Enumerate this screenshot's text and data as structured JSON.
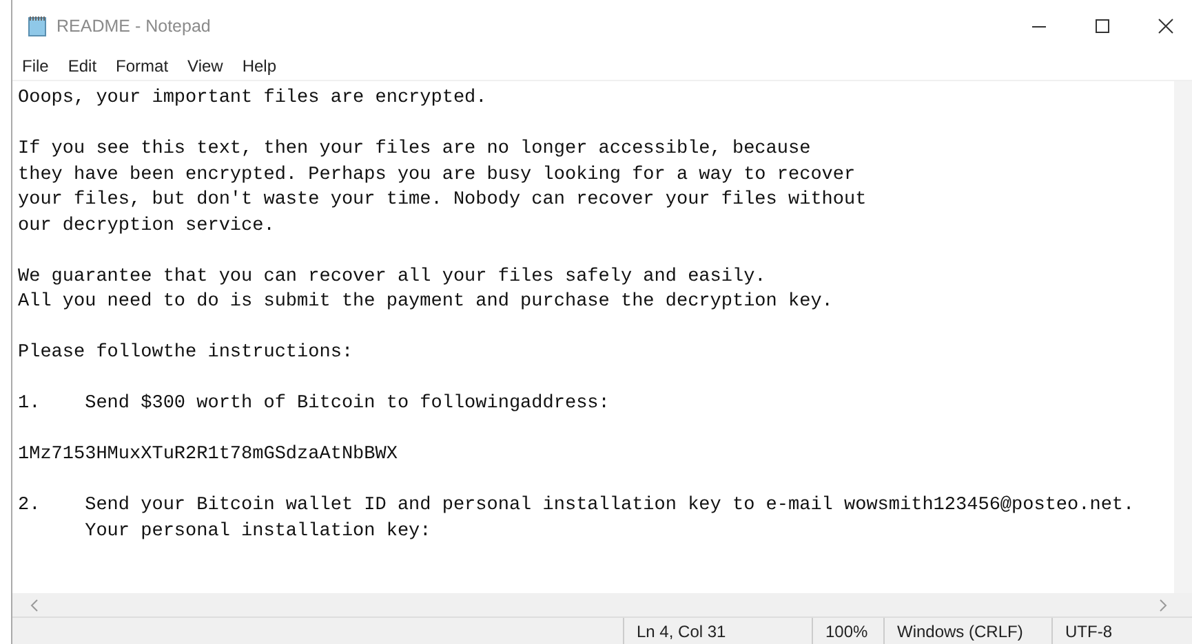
{
  "window": {
    "title": "README - Notepad"
  },
  "menu": [
    "File",
    "Edit",
    "Format",
    "View",
    "Help"
  ],
  "editor": {
    "paragraphs": [
      [
        "Ooops, your important files are encrypted."
      ],
      [
        "If you see this text, then your files are no longer accessible, because",
        "they have been encrypted. Perhaps you are busy looking for a way to recover",
        "your files, but don't waste your time. Nobody can recover your files without",
        "our decryption service."
      ],
      [
        "We guarantee that you can recover all your files safely and easily.",
        "All you need to do is submit the payment and purchase the decryption key."
      ],
      [
        "Please followthe instructions:"
      ],
      [
        "1.    Send $300 worth of Bitcoin to followingaddress:"
      ],
      [
        "1Mz7153HMuxXTuR2R1t78mGSdzaAtNbBWX"
      ],
      [
        "2.    Send your Bitcoin wallet ID and personal installation key to e-mail wowsmith123456@posteo.net.",
        "      Your personal installation key:"
      ]
    ]
  },
  "status_bar": [
    "Ln 4, Col 31",
    "100%",
    "Windows (CRLF)",
    "UTF-8"
  ]
}
